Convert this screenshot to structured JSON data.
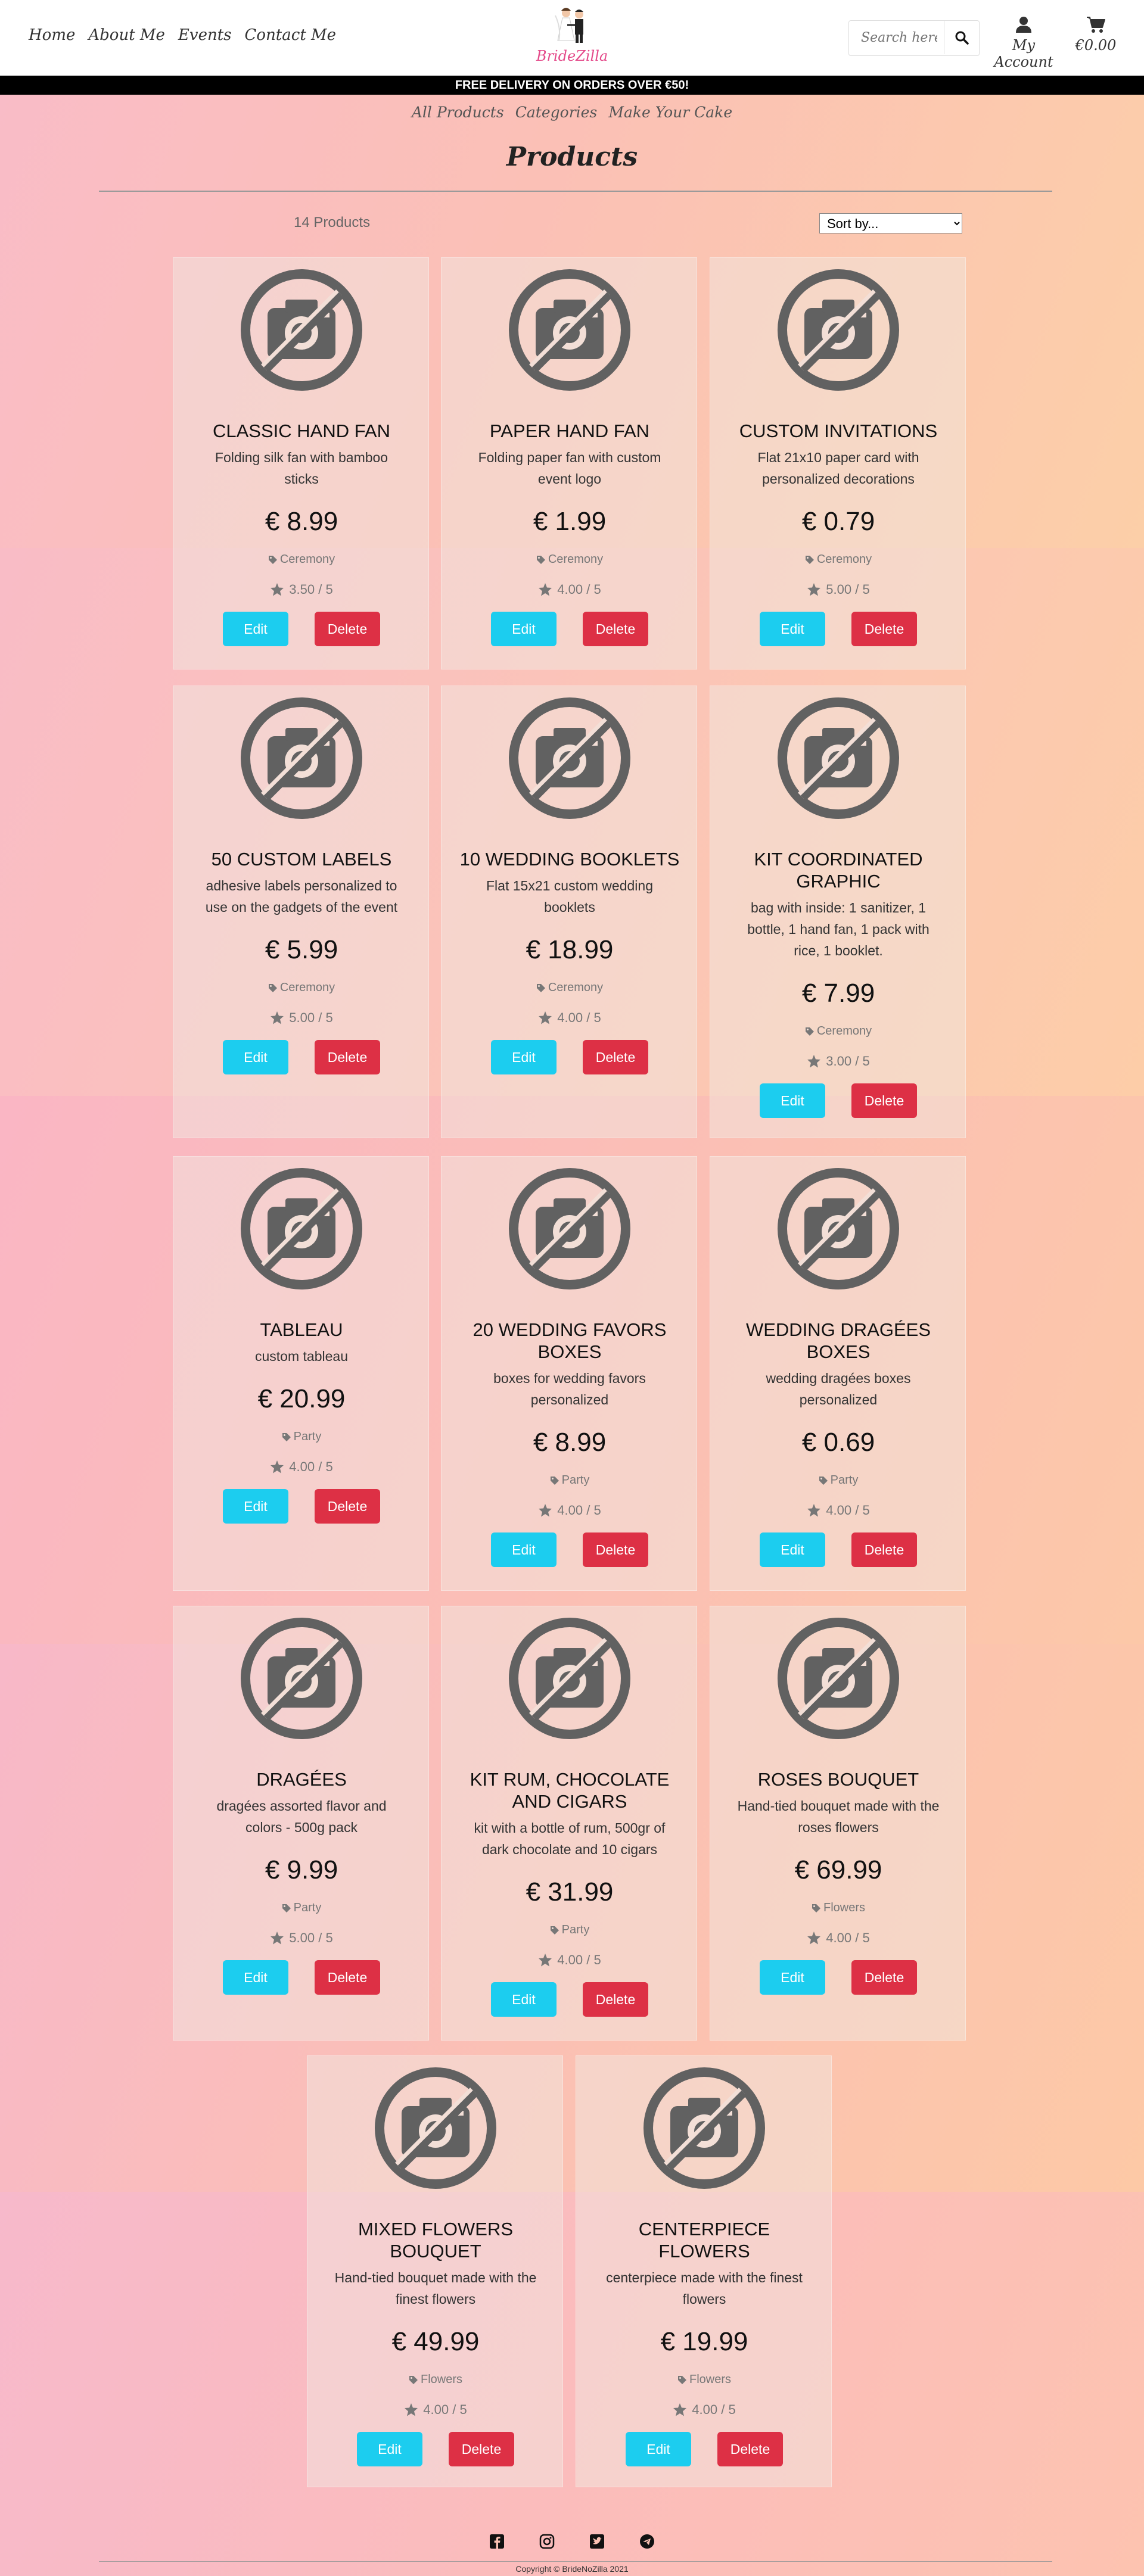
{
  "header": {
    "nav": [
      "Home",
      "About Me",
      "Events",
      "Contact Me"
    ],
    "logo_text": "BrideZilla",
    "search_placeholder": "Search here",
    "account_label": "My Account",
    "basket_total": "€0.00"
  },
  "banner": "FREE DELIVERY ON ORDERS OVER €50!",
  "subnav": [
    "All Products",
    "Categories",
    "Make Your Cake"
  ],
  "page_title": "Products",
  "product_count": "14 Products",
  "sort_label": "Sort by...",
  "products": [
    {
      "name": "CLASSIC HAND FAN",
      "description": "Folding silk fan with bamboo sticks",
      "price": "€ 8.99",
      "category": "Ceremony",
      "rating": "3.50 / 5",
      "edit": "Edit",
      "delete": "Delete"
    },
    {
      "name": "PAPER HAND FAN",
      "description": "Folding paper fan with custom event logo",
      "price": "€ 1.99",
      "category": "Ceremony",
      "rating": "4.00 / 5",
      "edit": "Edit",
      "delete": "Delete"
    },
    {
      "name": "CUSTOM INVITATIONS",
      "description": "Flat 21x10 paper card with personalized decorations",
      "price": "€ 0.79",
      "category": "Ceremony",
      "rating": "5.00 / 5",
      "edit": "Edit",
      "delete": "Delete"
    },
    {
      "name": "50 CUSTOM LABELS",
      "description": "adhesive labels personalized to use on the gadgets of the event",
      "price": "€ 5.99",
      "category": "Ceremony",
      "rating": "5.00 / 5",
      "edit": "Edit",
      "delete": "Delete"
    },
    {
      "name": "10 WEDDING BOOKLETS",
      "description": "Flat 15x21 custom wedding booklets",
      "price": "€ 18.99",
      "category": "Ceremony",
      "rating": "4.00 / 5",
      "edit": "Edit",
      "delete": "Delete"
    },
    {
      "name": "KIT COORDINATED GRAPHIC",
      "description": "bag with inside: 1 sanitizer, 1 bottle, 1 hand fan, 1 pack with rice, 1 booklet.",
      "price": "€ 7.99",
      "category": "Ceremony",
      "rating": "3.00 / 5",
      "edit": "Edit",
      "delete": "Delete"
    },
    {
      "name": "TABLEAU",
      "description": "custom tableau",
      "price": "€ 20.99",
      "category": "Party",
      "rating": "4.00 / 5",
      "edit": "Edit",
      "delete": "Delete"
    },
    {
      "name": "20 WEDDING FAVORS BOXES",
      "description": "boxes for wedding favors personalized",
      "price": "€ 8.99",
      "category": "Party",
      "rating": "4.00 / 5",
      "edit": "Edit",
      "delete": "Delete"
    },
    {
      "name": "WEDDING DRAGÉES BOXES",
      "description": "wedding dragées boxes personalized",
      "price": "€ 0.69",
      "category": "Party",
      "rating": "4.00 / 5",
      "edit": "Edit",
      "delete": "Delete"
    },
    {
      "name": "DRAGÉES",
      "description": "dragées assorted flavor and colors - 500g pack",
      "price": "€ 9.99",
      "category": "Party",
      "rating": "5.00 / 5",
      "edit": "Edit",
      "delete": "Delete"
    },
    {
      "name": "KIT RUM, CHOCOLATE AND CIGARS",
      "description": "kit with a bottle of rum, 500gr of dark chocolate and 10 cigars",
      "price": "€ 31.99",
      "category": "Party",
      "rating": "4.00 / 5",
      "edit": "Edit",
      "delete": "Delete"
    },
    {
      "name": "ROSES BOUQUET",
      "description": "Hand-tied bouquet made with the roses flowers",
      "price": "€ 69.99",
      "category": "Flowers",
      "rating": "4.00 / 5",
      "edit": "Edit",
      "delete": "Delete"
    },
    {
      "name": "MIXED FLOWERS BOUQUET",
      "description": "Hand-tied bouquet made with the finest flowers",
      "price": "€ 49.99",
      "category": "Flowers",
      "rating": "4.00 / 5",
      "edit": "Edit",
      "delete": "Delete"
    },
    {
      "name": "CENTERPIECE FLOWERS",
      "description": "centerpiece made with the finest flowers",
      "price": "€ 19.99",
      "category": "Flowers",
      "rating": "4.00 / 5",
      "edit": "Edit",
      "delete": "Delete"
    }
  ],
  "footer": {
    "icons": [
      "facebook-icon",
      "instagram-icon",
      "twitter-icon",
      "telegram-icon"
    ],
    "copyright": "Copyright © BrideNoZilla 2021"
  },
  "colors": {
    "edit_button": "#1ccdef",
    "delete_button": "#dd3045",
    "banner": "#000000"
  }
}
